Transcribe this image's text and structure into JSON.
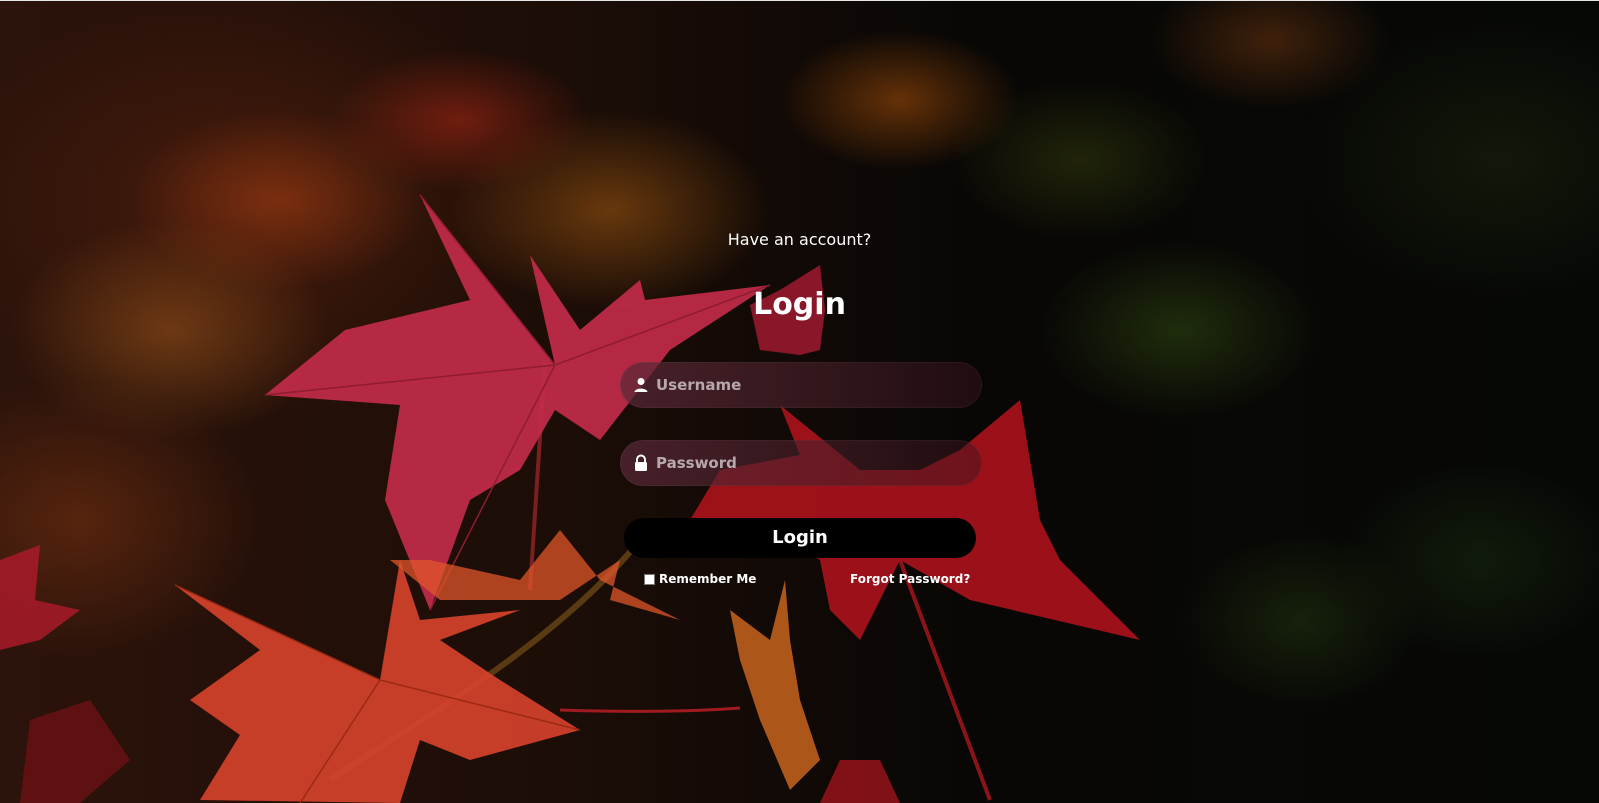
{
  "form": {
    "subtitle": "Have an account?",
    "title": "Login",
    "username": {
      "placeholder": "Username",
      "value": "",
      "icon": "user-icon"
    },
    "password": {
      "placeholder": "Password",
      "value": "",
      "icon": "lock-icon"
    },
    "submit_label": "Login",
    "remember_me": {
      "label": "Remember Me",
      "checked": false
    },
    "forgot_password_label": "Forgot Password?"
  },
  "colors": {
    "text": "#ffffff",
    "button_bg": "#000000",
    "field_bg": "#5a2837"
  }
}
